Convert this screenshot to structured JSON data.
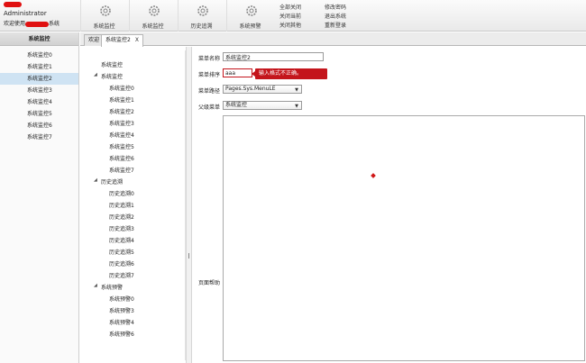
{
  "header": {
    "user": "Administrator",
    "welcome_prefix": "欢迎使用",
    "welcome_suffix": "系统"
  },
  "toolbar": {
    "buttons": [
      {
        "label": "系统监控",
        "icon": "gear-icon"
      },
      {
        "label": "系统监控",
        "icon": "gear-icon"
      },
      {
        "label": "历史追溯",
        "icon": "gear-icon"
      },
      {
        "label": "系统预警",
        "icon": "gear-icon"
      }
    ],
    "links": [
      "全部关闭",
      "关闭当前",
      "关闭其他",
      "修改密码",
      "退出系统",
      "重新登录"
    ]
  },
  "sidebar": {
    "title": "系统监控",
    "items": [
      "系统监控0",
      "系统监控1",
      "系统监控2",
      "系统监控3",
      "系统监控4",
      "系统监控5",
      "系统监控6",
      "系统监控7"
    ],
    "selected_index": 2
  },
  "tabs": [
    {
      "label": "欢迎",
      "closable": false
    },
    {
      "label": "系统监控2",
      "closable": true,
      "close_glyph": "X"
    }
  ],
  "tree": {
    "root": "系统监控",
    "groups": [
      {
        "label": "系统监控",
        "children": [
          "系统监控0",
          "系统监控1",
          "系统监控2",
          "系统监控3",
          "系统监控4",
          "系统监控5",
          "系统监控6",
          "系统监控7"
        ]
      },
      {
        "label": "历史追溯",
        "children": [
          "历史追溯0",
          "历史追溯1",
          "历史追溯2",
          "历史追溯3",
          "历史追溯4",
          "历史追溯5",
          "历史追溯6",
          "历史追溯7"
        ]
      },
      {
        "label": "系统预警",
        "children": [
          "系统预警0",
          "系统预警3",
          "系统预警4",
          "系统预警6"
        ]
      }
    ]
  },
  "form": {
    "name_label": "菜单名称",
    "name_value": "系统监控2",
    "order_label": "菜单排序",
    "order_value": "aaa",
    "error_message": "输入格式不正确。",
    "path_label": "菜单路径",
    "path_value": "Pages.Sys.MenuLE",
    "parent_label": "父级菜单",
    "parent_value": "系统监控",
    "help_label": "页面帮助"
  },
  "colors": {
    "error": "#c4151c",
    "selected_row": "#cfe3f3",
    "redaction": "#e01010"
  }
}
